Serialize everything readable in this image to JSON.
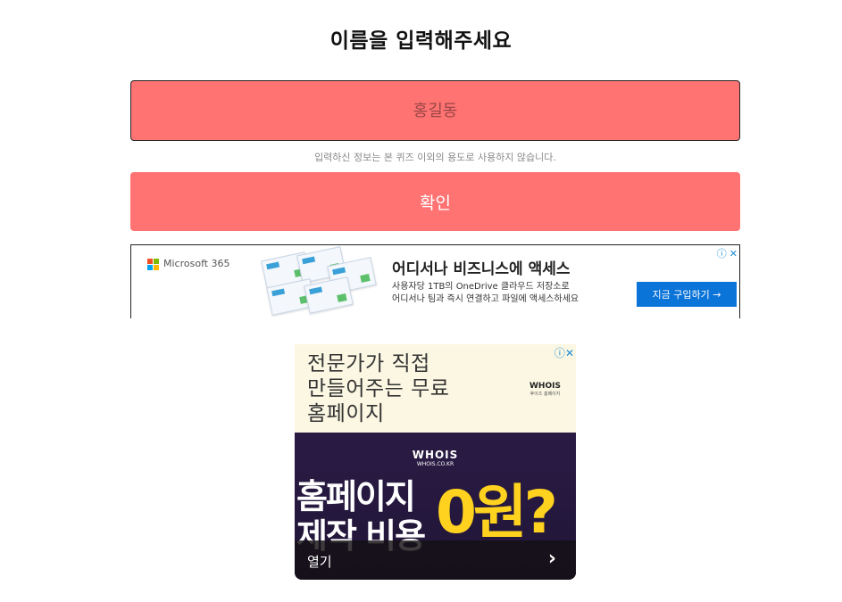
{
  "page": {
    "title": "이름을 입력해주세요",
    "name_placeholder": "홍길동",
    "notice": "입력하신 정보는 본 퀴즈 이외의 용도로 사용하지 않습니다.",
    "confirm_label": "확인"
  },
  "ad_banner": {
    "brand": "Microsoft 365",
    "headline": "어디서나 비즈니스에 액세스",
    "desc_line1": "사용자당 1TB의 OneDrive 클라우드 저장소로",
    "desc_line2": "어디서나 팀과 즉시 연결하고 파일에 액세스하세요",
    "cta": "지금 구입하기 →",
    "ad_choices_icon": "ⓘ",
    "close_icon": "✕"
  },
  "ad_square": {
    "top_text": "전문가가 직접\n만들어주는 무료\n홈페이지",
    "logo_small": "WHOIS",
    "logo_small_sub": "후이즈 홈페이지",
    "logo_main": "WHOIS",
    "logo_main_sub": "WHOIS.CO.KR",
    "big_text": "홈페이지\n제작 비용",
    "price_text": "0원?",
    "open_label": "열기",
    "chevron": "›",
    "ad_choices_icon": "ⓘ",
    "close_icon": "✕"
  },
  "colors": {
    "accent": "#ff7373",
    "cta_blue": "#0b74d8",
    "price_yellow": "#ffd21f"
  }
}
